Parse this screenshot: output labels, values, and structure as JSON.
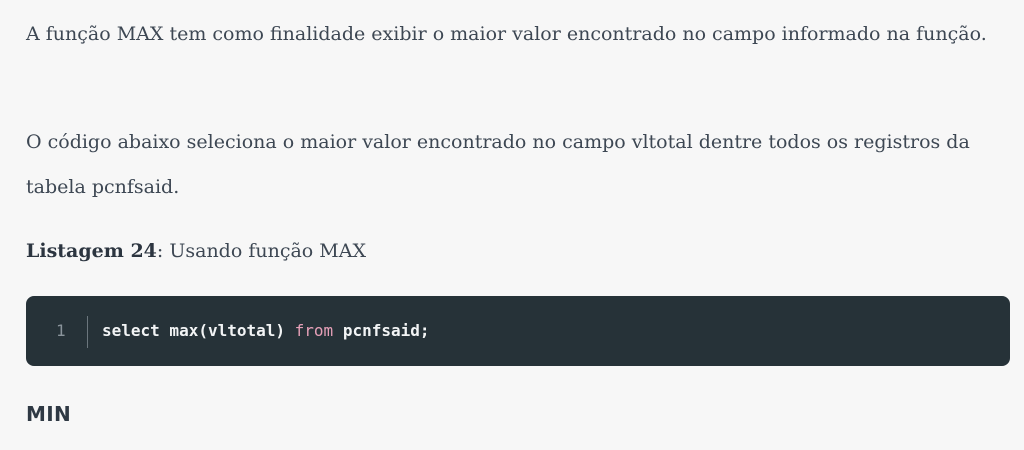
{
  "paragraphs": {
    "p1": "A função MAX tem como finalidade exibir o maior valor encontrado no campo informado na função.",
    "p2": "O código abaixo seleciona o maior valor encontrado no campo vltotal dentre todos os registros da tabela pcnfsaid."
  },
  "caption": {
    "label": "Listagem 24",
    "separator": ":",
    "text": " Usando função MAX"
  },
  "code": {
    "line_number": "1",
    "tokens": {
      "part1": "select max(vltotal) ",
      "keyword_from": "from",
      "part2": " pcnfsaid;"
    }
  },
  "section_heading": "MIN"
}
